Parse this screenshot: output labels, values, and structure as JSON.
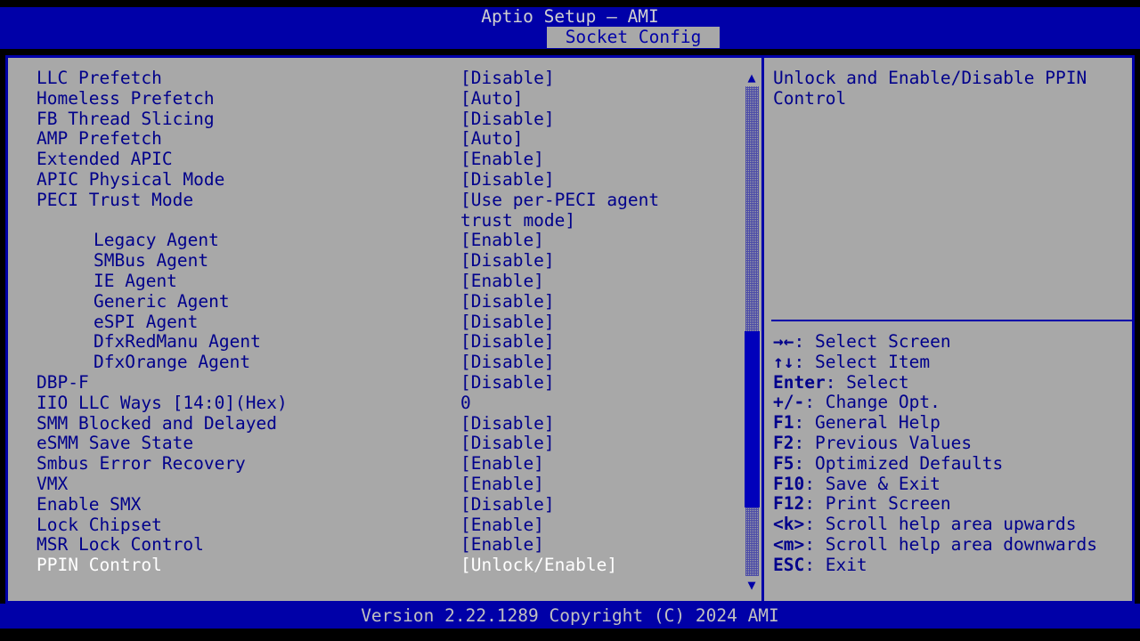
{
  "header": {
    "app_title": "Aptio Setup – AMI",
    "active_tab": "Socket Config",
    "header_bg": "#0000a8",
    "tab_bg": "#a8a8a8",
    "tab_fg": "#0000a8"
  },
  "colors": {
    "panel_bg": "#a8a8a8",
    "border": "#0000a8",
    "text": "#00008b",
    "selected_text": "#ffffff",
    "scrollbar_thumb": "#0000bb",
    "footer_bg": "#0000a8",
    "footer_fg": "#c0c0c0"
  },
  "settings": {
    "rows": [
      {
        "label": "LLC Prefetch",
        "value": "[Disable]",
        "indent": false,
        "selected": false
      },
      {
        "label": "Homeless Prefetch",
        "value": "[Auto]",
        "indent": false,
        "selected": false
      },
      {
        "label": "FB Thread Slicing",
        "value": "[Disable]",
        "indent": false,
        "selected": false
      },
      {
        "label": "AMP Prefetch",
        "value": "[Auto]",
        "indent": false,
        "selected": false
      },
      {
        "label": "Extended APIC",
        "value": "[Enable]",
        "indent": false,
        "selected": false
      },
      {
        "label": "APIC Physical Mode",
        "value": "[Disable]",
        "indent": false,
        "selected": false
      },
      {
        "label": "PECI Trust Mode",
        "value": "[Use per-PECI agent",
        "indent": false,
        "selected": false
      },
      {
        "label": "",
        "value": "trust mode]",
        "indent": false,
        "selected": false
      },
      {
        "label": "Legacy Agent",
        "value": "[Enable]",
        "indent": true,
        "selected": false
      },
      {
        "label": "SMBus Agent",
        "value": "[Disable]",
        "indent": true,
        "selected": false
      },
      {
        "label": "IE Agent",
        "value": "[Enable]",
        "indent": true,
        "selected": false
      },
      {
        "label": "Generic Agent",
        "value": "[Disable]",
        "indent": true,
        "selected": false
      },
      {
        "label": "eSPI Agent",
        "value": "[Disable]",
        "indent": true,
        "selected": false
      },
      {
        "label": "DfxRedManu Agent",
        "value": "[Disable]",
        "indent": true,
        "selected": false
      },
      {
        "label": "DfxOrange Agent",
        "value": "[Disable]",
        "indent": true,
        "selected": false
      },
      {
        "label": "DBP-F",
        "value": "[Disable]",
        "indent": false,
        "selected": false
      },
      {
        "label": "IIO LLC Ways [14:0](Hex)",
        "value": "0",
        "indent": false,
        "selected": false
      },
      {
        "label": "SMM Blocked and Delayed",
        "value": "[Disable]",
        "indent": false,
        "selected": false
      },
      {
        "label": "eSMM Save State",
        "value": "[Disable]",
        "indent": false,
        "selected": false
      },
      {
        "label": "Smbus Error Recovery",
        "value": "[Enable]",
        "indent": false,
        "selected": false
      },
      {
        "label": "VMX",
        "value": "[Enable]",
        "indent": false,
        "selected": false
      },
      {
        "label": "Enable SMX",
        "value": "[Disable]",
        "indent": false,
        "selected": false
      },
      {
        "label": "Lock Chipset",
        "value": "[Enable]",
        "indent": false,
        "selected": false
      },
      {
        "label": "MSR Lock Control",
        "value": "[Enable]",
        "indent": false,
        "selected": false
      },
      {
        "label": "PPIN Control",
        "value": "[Unlock/Enable]",
        "indent": false,
        "selected": true
      }
    ]
  },
  "scrollbar": {
    "up_arrow": "▲",
    "down_arrow": "▼",
    "thumb_top_pct": 50,
    "thumb_height_pct": 36
  },
  "help": {
    "text": "Unlock and Enable/Disable PPIN Control",
    "legend": [
      {
        "keys": "→←",
        "desc": ": Select Screen"
      },
      {
        "keys": "↑↓",
        "desc": ": Select Item"
      },
      {
        "keys": "Enter",
        "desc": ": Select"
      },
      {
        "keys": "+/-",
        "desc": ": Change Opt."
      },
      {
        "keys": "F1",
        "desc": ": General Help"
      },
      {
        "keys": "F2",
        "desc": ": Previous Values"
      },
      {
        "keys": "F5",
        "desc": ": Optimized Defaults"
      },
      {
        "keys": "F10",
        "desc": ": Save & Exit"
      },
      {
        "keys": "F12",
        "desc": ": Print Screen"
      },
      {
        "keys": "<k>",
        "desc": ": Scroll help area upwards"
      },
      {
        "keys": "<m>",
        "desc": ": Scroll help area downwards"
      },
      {
        "keys": "ESC",
        "desc": ": Exit"
      }
    ]
  },
  "footer": {
    "version_text": "Version 2.22.1289 Copyright (C) 2024 AMI"
  }
}
